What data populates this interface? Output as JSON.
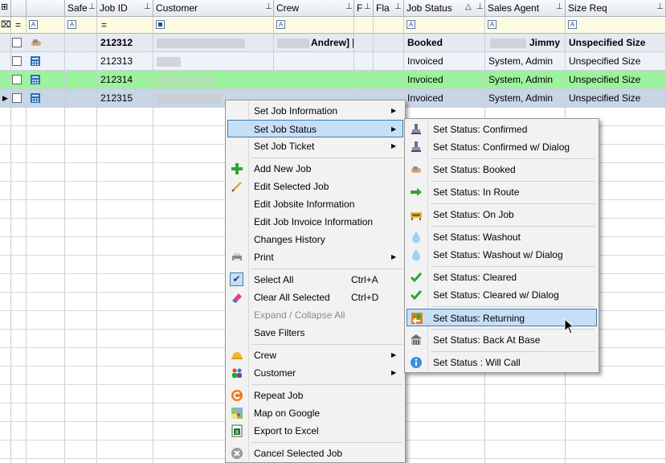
{
  "columns": {
    "safe": "Safe",
    "job_id": "Job ID",
    "customer": "Customer",
    "crew": "Crew",
    "f": "F",
    "fla": "Fla",
    "job_status": "Job Status",
    "sales_agent": "Sales Agent",
    "size_req": "Size Req"
  },
  "filter_row": {
    "equals_symbol": "=",
    "fbox_letter": "A"
  },
  "rows": [
    {
      "job_id": "212312",
      "crew": "Andrew] [",
      "status": "Booked",
      "agent": "Jimmy",
      "size": "Unspecified Size"
    },
    {
      "job_id": "212313",
      "crew": "",
      "status": "Invoiced",
      "agent": "System, Admin",
      "size": "Unspecified Size"
    },
    {
      "job_id": "212314",
      "crew": "",
      "status": "Invoiced",
      "agent": "System, Admin",
      "size": "Unspecified Size"
    },
    {
      "job_id": "212315",
      "crew": "",
      "status": "Invoiced",
      "agent": "System, Admin",
      "size": "Unspecified Size"
    }
  ],
  "context_menu": {
    "set_job_information": "Set Job Information",
    "set_job_status": "Set Job Status",
    "set_job_ticket": "Set Job Ticket",
    "add_new_job": "Add New Job",
    "edit_selected_job": "Edit Selected Job",
    "edit_jobsite_information": "Edit Jobsite Information",
    "edit_job_invoice_information": "Edit Job Invoice Information",
    "changes_history": "Changes History",
    "print": "Print",
    "select_all": "Select All",
    "select_all_shortcut": "Ctrl+A",
    "clear_all_selected": "Clear All Selected",
    "clear_all_selected_shortcut": "Ctrl+D",
    "expand_collapse_all": "Expand / Collapse All",
    "save_filters": "Save Filters",
    "crew": "Crew",
    "customer": "Customer",
    "repeat_job": "Repeat Job",
    "map_on_google": "Map on Google",
    "export_to_excel": "Export to Excel",
    "cancel_selected_job": "Cancel Selected Job"
  },
  "status_submenu": {
    "confirmed": "Set Status: Confirmed",
    "confirmed_dialog": "Set Status: Confirmed w/ Dialog",
    "booked": "Set Status: Booked",
    "in_route": "Set Status: In Route",
    "on_job": "Set Status: On Job",
    "washout": "Set Status: Washout",
    "washout_dialog": "Set Status: Washout w/ Dialog",
    "cleared": "Set Status: Cleared",
    "cleared_dialog": "Set Status: Cleared w/ Dialog",
    "returning": "Set Status: Returning",
    "back_at_base": "Set Status: Back At Base",
    "will_call": "Set Status : Will Call"
  },
  "colors": {
    "highlight_bg": "#c7dff6",
    "highlight_border": "#3c7fb1",
    "green_row": "#9df29d",
    "filter_row_bg": "#fdfbe2"
  }
}
